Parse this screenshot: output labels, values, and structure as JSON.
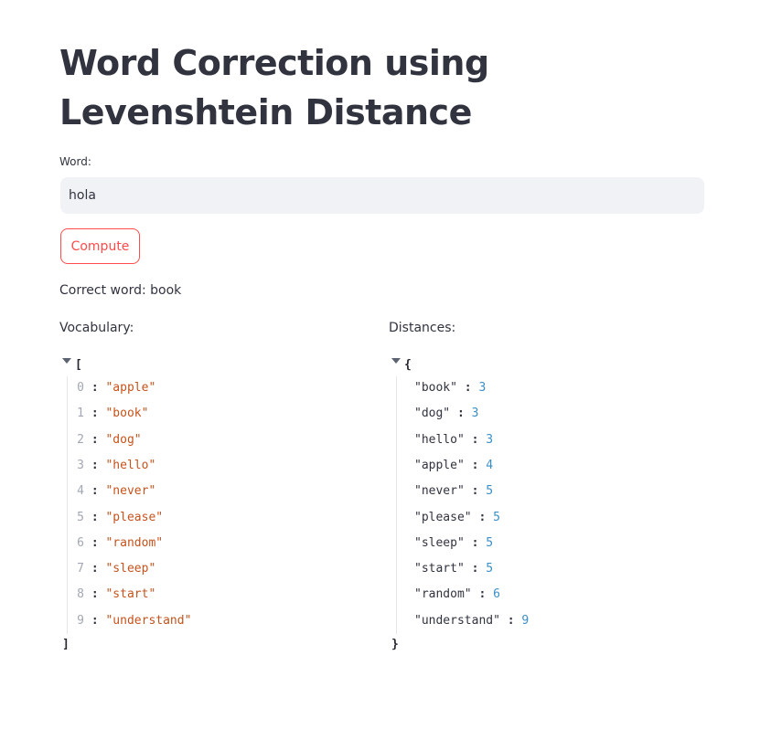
{
  "title": "Word Correction using Levenshtein Distance",
  "input": {
    "label": "Word:",
    "value": "hola"
  },
  "compute_button": "Compute",
  "result": "Correct word: book",
  "vocabulary": {
    "label": "Vocabulary:",
    "open": "[",
    "close": "]",
    "items": [
      {
        "index": "0",
        "value": "\"apple\""
      },
      {
        "index": "1",
        "value": "\"book\""
      },
      {
        "index": "2",
        "value": "\"dog\""
      },
      {
        "index": "3",
        "value": "\"hello\""
      },
      {
        "index": "4",
        "value": "\"never\""
      },
      {
        "index": "5",
        "value": "\"please\""
      },
      {
        "index": "6",
        "value": "\"random\""
      },
      {
        "index": "7",
        "value": "\"sleep\""
      },
      {
        "index": "8",
        "value": "\"start\""
      },
      {
        "index": "9",
        "value": "\"understand\""
      }
    ]
  },
  "distances": {
    "label": "Distances:",
    "open": "{",
    "close": "}",
    "items": [
      {
        "key": "\"book\"",
        "value": "3"
      },
      {
        "key": "\"dog\"",
        "value": "3"
      },
      {
        "key": "\"hello\"",
        "value": "3"
      },
      {
        "key": "\"apple\"",
        "value": "4"
      },
      {
        "key": "\"never\"",
        "value": "5"
      },
      {
        "key": "\"please\"",
        "value": "5"
      },
      {
        "key": "\"sleep\"",
        "value": "5"
      },
      {
        "key": "\"start\"",
        "value": "5"
      },
      {
        "key": "\"random\"",
        "value": "6"
      },
      {
        "key": "\"understand\"",
        "value": "9"
      }
    ]
  },
  "colors": {
    "accent": "#ff4b4b",
    "text": "#31333f",
    "input_bg": "#f0f2f6",
    "json_string": "#c4531d",
    "json_number": "#3a8fc6",
    "json_index": "#a2a7b4"
  },
  "icons": {
    "collapse_toggle": "caret-down-icon"
  }
}
